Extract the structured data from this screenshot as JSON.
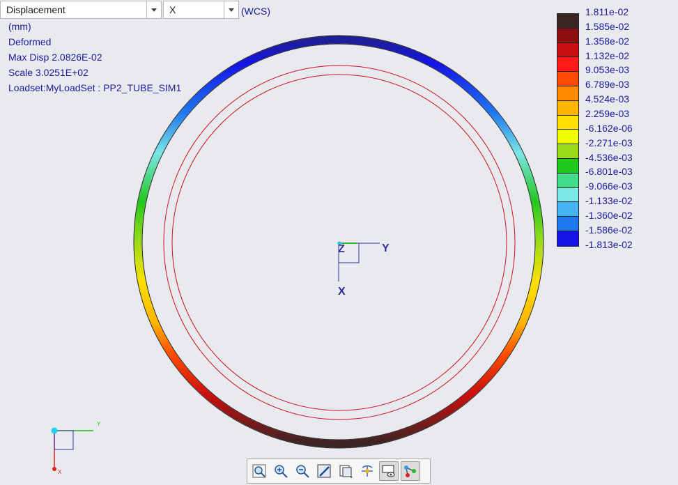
{
  "header": {
    "result_type": "Displacement",
    "component": "X",
    "coord_system": "(WCS)"
  },
  "info": {
    "units": "(mm)",
    "mode": "Deformed",
    "max_disp": "Max Disp  2.0826E-02",
    "scale": "Scale  3.0251E+02",
    "loadset": "Loadset:MyLoadSet :  PP2_TUBE_SIM1"
  },
  "legend": {
    "labels": [
      "1.811e-02",
      "1.585e-02",
      "1.358e-02",
      "1.132e-02",
      "9.053e-03",
      "6.789e-03",
      "4.524e-03",
      "2.259e-03",
      "-6.162e-06",
      "-2.271e-03",
      "-4.536e-03",
      "-6.801e-03",
      "-9.066e-03",
      "-1.133e-02",
      "-1.360e-02",
      "-1.586e-02",
      "-1.813e-02"
    ],
    "colors": [
      "#3b2424",
      "#8c0f0f",
      "#c80e0e",
      "#ff1a1a",
      "#ff4a00",
      "#ff8a00",
      "#ffb400",
      "#ffe000",
      "#f0ff00",
      "#9adc1a",
      "#22c81e",
      "#44dc8c",
      "#7ae6e6",
      "#46b4f0",
      "#1e78f0",
      "#1414e6",
      "#1e1e96"
    ]
  },
  "triad": {
    "z_label": "Z",
    "y_label": "Y",
    "x_label": "X"
  },
  "mini_triad": {
    "y_label": "Y",
    "x_label": "X"
  },
  "toolbar": {
    "icons": [
      "refit-icon",
      "zoom-in-icon",
      "zoom-out-icon",
      "repaint-icon",
      "saved-views-icon",
      "spin-center-icon",
      "display-style-icon",
      "datum-display-icon"
    ]
  }
}
